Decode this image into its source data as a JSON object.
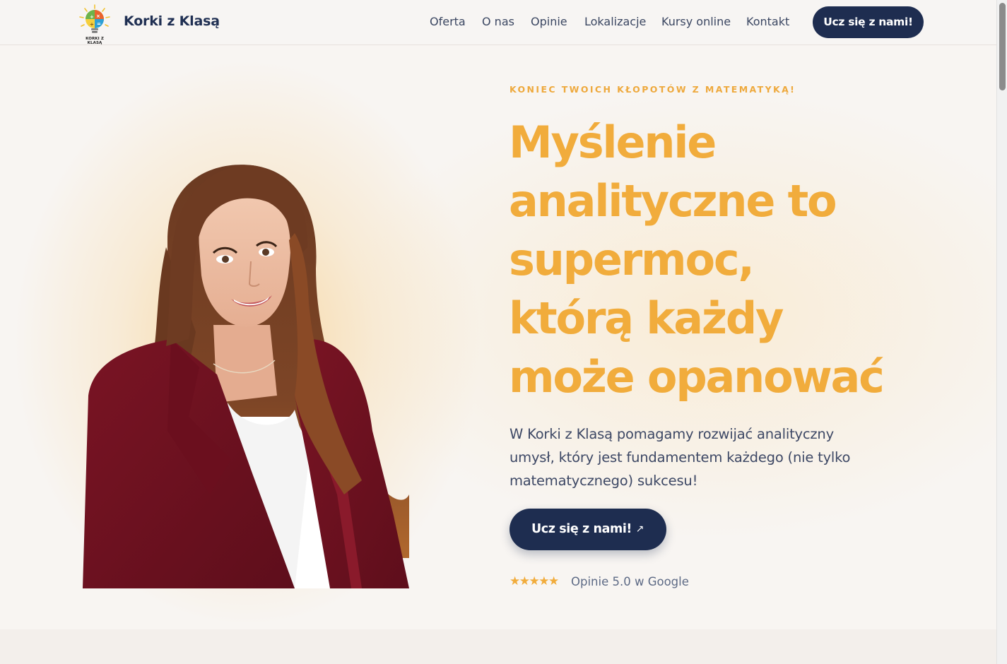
{
  "header": {
    "logo_caption": "KORKI Z KLASĄ",
    "brand": "Korki z Klasą",
    "nav": [
      "Oferta",
      "O nas",
      "Opinie",
      "Lokalizacje",
      "Kursy online",
      "Kontakt"
    ],
    "cta": "Ucz się z nami!"
  },
  "hero": {
    "eyebrow": "KONIEC TWOICH KŁOPOTÓW Z MATEMATYKĄ!",
    "headline": "Myślenie analityczne to supermoc, którą każdy może opanować",
    "lede": "W Korki z Klasą pomagamy rozwijać analityczny umysł, który jest fundamentem każdego (nie tylko matematycznego) sukcesu!",
    "cta": "Ucz się z nami!",
    "cta_icon": "arrow-up-right-icon",
    "stars": "★★★★★",
    "rating_text": "Opinie 5.0 w Google",
    "portrait_icon": "teacher-portrait-photo"
  },
  "colors": {
    "navy": "#1e2d50",
    "accent": "#f1ac3c",
    "background": "#f8f5f2"
  }
}
